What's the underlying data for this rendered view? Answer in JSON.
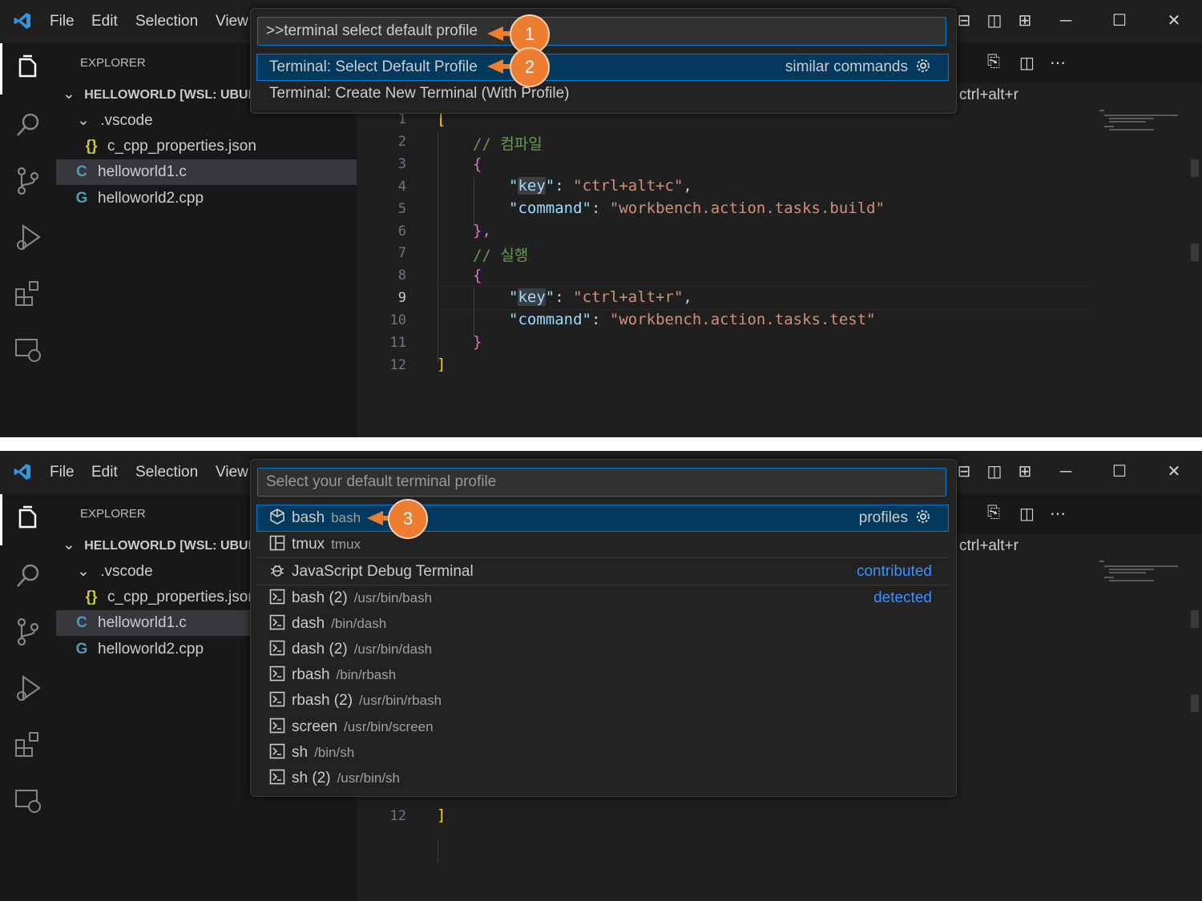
{
  "menu": {
    "file": "File",
    "edit": "Edit",
    "selection": "Selection",
    "view": "View"
  },
  "colors": {
    "accent": "#0078d4",
    "callout": "#ed7d31",
    "json_icon": "#cbcb41",
    "c_icon": "#519aba"
  },
  "explorer": {
    "title": "EXPLORER",
    "workspace": "HELLOWORLD [WSL: UBUNT",
    "folder": ".vscode",
    "files": [
      "c_cpp_properties.json",
      "helloworld1.c",
      "helloworld2.cpp"
    ],
    "file2_trunc": "c_cpp_properties.json"
  },
  "editor": {
    "keyhint": "ctrl+alt+r",
    "lines": [
      "1",
      "2",
      "3",
      "4",
      "5",
      "6",
      "7",
      "8",
      "9",
      "10",
      "11",
      "12"
    ],
    "code": {
      "open_bracket": "[",
      "close_bracket": "]",
      "comment_compile": "// 컴파일",
      "comment_run": "// 실행",
      "open_brace": "{",
      "close_brace_comma": "},",
      "close_brace": "}",
      "key": "key",
      "command": "command",
      "key1_val": "\"ctrl+alt+c\"",
      "cmd1_val": "\"workbench.action.tasks.build\"",
      "key2_val": "\"ctrl+alt+r\"",
      "cmd2_val": "\"workbench.action.tasks.test\""
    }
  },
  "step1": {
    "input_value": ">>terminal select default profile",
    "items": [
      {
        "label": "Terminal: Select Default Profile",
        "right": "similar commands"
      },
      {
        "label": "Terminal: Create New Terminal (With Profile)"
      }
    ],
    "callouts": [
      "1",
      "2"
    ]
  },
  "step2": {
    "input_placeholder": "Select your default terminal profile",
    "items": [
      {
        "label": "bash",
        "desc": "bash",
        "right": "profiles",
        "icon": "shell-cube-icon"
      },
      {
        "label": "tmux",
        "desc": "tmux",
        "icon": "layout-icon"
      },
      {
        "label": "JavaScript Debug Terminal",
        "desc": "",
        "right": "contributed",
        "icon": "debug-bug-icon"
      },
      {
        "label": "bash (2)",
        "desc": "/usr/bin/bash",
        "right": "detected",
        "icon": "terminal-icon"
      },
      {
        "label": "dash",
        "desc": "/bin/dash",
        "icon": "terminal-icon"
      },
      {
        "label": "dash (2)",
        "desc": "/usr/bin/dash",
        "icon": "terminal-icon"
      },
      {
        "label": "rbash",
        "desc": "/bin/rbash",
        "icon": "terminal-icon"
      },
      {
        "label": "rbash (2)",
        "desc": "/usr/bin/rbash",
        "icon": "terminal-icon"
      },
      {
        "label": "screen",
        "desc": "/usr/bin/screen",
        "icon": "terminal-icon"
      },
      {
        "label": "sh",
        "desc": "/bin/sh",
        "icon": "terminal-icon"
      },
      {
        "label": "sh (2)",
        "desc": "/usr/bin/sh",
        "icon": "terminal-icon"
      }
    ],
    "callouts": [
      "3"
    ],
    "editor_last_line": "12",
    "editor_last_bracket": "]"
  }
}
